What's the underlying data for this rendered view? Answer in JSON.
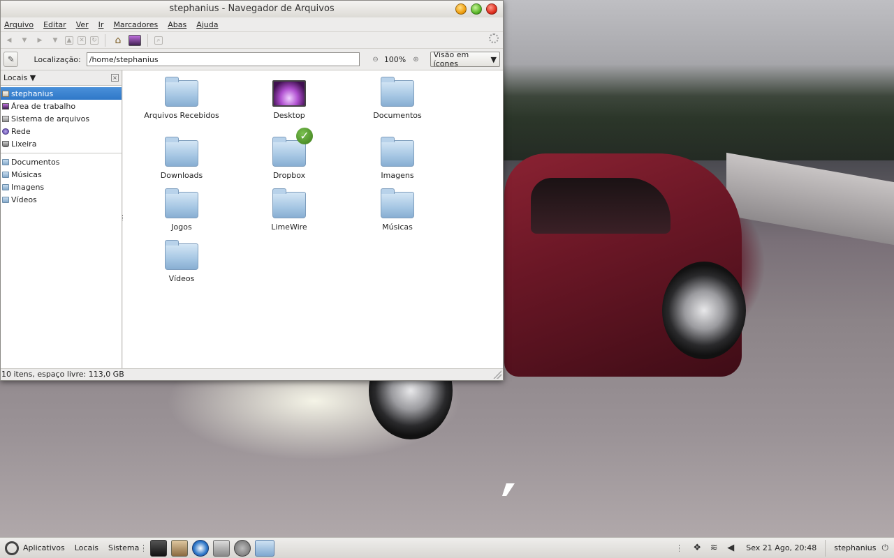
{
  "window": {
    "title": "stephanius - Navegador de Arquivos"
  },
  "menubar": {
    "items": [
      "Arquivo",
      "Editar",
      "Ver",
      "Ir",
      "Marcadores",
      "Abas",
      "Ajuda"
    ]
  },
  "locationbar": {
    "label": "Localização:",
    "path": "/home/stephanius",
    "zoom": "100%",
    "view_mode": "Visão em ícones"
  },
  "sidebar": {
    "header": "Locais",
    "places": [
      {
        "label": "stephanius",
        "icon": "home-icon",
        "selected": true
      },
      {
        "label": "Área de trabalho",
        "icon": "desktop-icon"
      },
      {
        "label": "Sistema de arquivos",
        "icon": "filesystem-icon"
      },
      {
        "label": "Rede",
        "icon": "network-icon"
      },
      {
        "label": "Lixeira",
        "icon": "trash-icon"
      }
    ],
    "bookmarks": [
      {
        "label": "Documentos",
        "icon": "folder-icon"
      },
      {
        "label": "Músicas",
        "icon": "folder-icon"
      },
      {
        "label": "Imagens",
        "icon": "folder-icon"
      },
      {
        "label": "Vídeos",
        "icon": "folder-icon"
      }
    ]
  },
  "files": [
    {
      "name": "Arquivos Recebidos",
      "icon": "folder-icon"
    },
    {
      "name": "Desktop",
      "icon": "desktop-folder-icon"
    },
    {
      "name": "Documentos",
      "icon": "folder-icon"
    },
    {
      "name": "Downloads",
      "icon": "folder-icon"
    },
    {
      "name": "Dropbox",
      "icon": "folder-icon",
      "emblem": "check-icon"
    },
    {
      "name": "Imagens",
      "icon": "folder-icon"
    },
    {
      "name": "Jogos",
      "icon": "folder-icon"
    },
    {
      "name": "LimeWire",
      "icon": "folder-icon"
    },
    {
      "name": "Músicas",
      "icon": "folder-icon"
    },
    {
      "name": "Vídeos",
      "icon": "folder-icon"
    }
  ],
  "statusbar": {
    "text": "10 itens, espaço livre: 113,0 GB"
  },
  "panel": {
    "menus": [
      "Aplicativos",
      "Locais",
      "Sistema"
    ],
    "clock": "Sex 21 Ago, 20:48",
    "user": "stephanius"
  },
  "colors": {
    "selection": "#2f78c8",
    "folder": "#a5c6e3",
    "window_bg": "#edeceb"
  }
}
